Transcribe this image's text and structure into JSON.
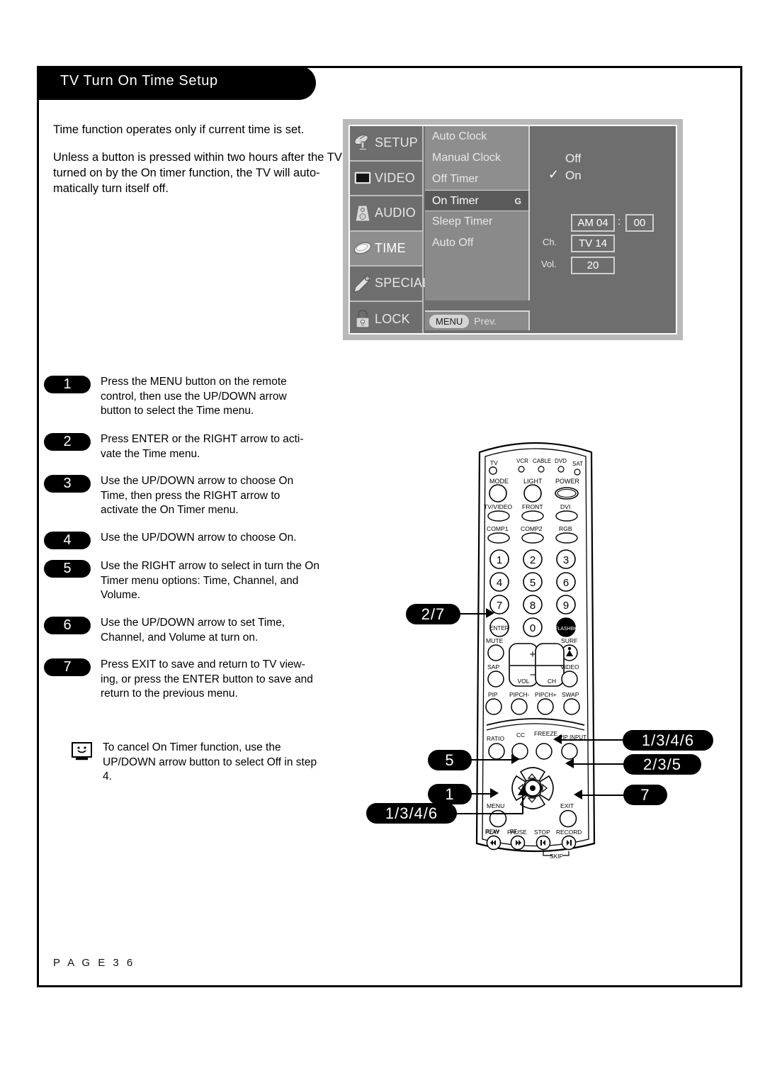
{
  "header": {
    "title": "TV Turn On Time Setup"
  },
  "intro": {
    "p1": "Time function operates only if current time is set.",
    "p2": "Unless a button is pressed within two hours after the TV is turned on by the On timer function, the TV will auto-matically turn itself off."
  },
  "osd": {
    "categories": [
      {
        "label": "SETUP",
        "icon": "satellite-dish-icon",
        "selected": false
      },
      {
        "label": "VIDEO",
        "icon": "tv-screen-icon",
        "selected": false
      },
      {
        "label": "AUDIO",
        "icon": "speaker-icon",
        "selected": false
      },
      {
        "label": "TIME",
        "icon": "clock-disc-icon",
        "selected": true
      },
      {
        "label": "SPECIAL",
        "icon": "key-icon",
        "selected": false
      },
      {
        "label": "LOCK",
        "icon": "padlock-icon",
        "selected": false
      }
    ],
    "items": [
      {
        "label": "Auto Clock",
        "highlighted": false,
        "marker": ""
      },
      {
        "label": "Manual Clock",
        "highlighted": false,
        "marker": ""
      },
      {
        "label": "Off Timer",
        "highlighted": false,
        "marker": ""
      },
      {
        "label": "On Timer",
        "highlighted": true,
        "marker": "G"
      },
      {
        "label": "Sleep Timer",
        "highlighted": false,
        "marker": ""
      },
      {
        "label": "Auto Off",
        "highlighted": false,
        "marker": ""
      }
    ],
    "footer": {
      "menu_pill": "MENU",
      "prev_label": "Prev."
    },
    "options": {
      "off": "Off",
      "on": "On",
      "checkmark": "✓"
    },
    "values": {
      "ampm_hour": "AM 04",
      "colon": ":",
      "minute": "00",
      "ch_label": "Ch.",
      "ch_value": "TV  14",
      "vol_label": "Vol.",
      "vol_value": "20"
    }
  },
  "steps": [
    {
      "num": "1",
      "text": "Press the MENU button on the remote control, then use the UP/DOWN arrow button to select the Time menu."
    },
    {
      "num": "2",
      "text": "Press ENTER or the RIGHT arrow to acti-vate the Time menu."
    },
    {
      "num": "3",
      "text": "Use the UP/DOWN arrow to choose On Time, then press the RIGHT arrow to activate the On Timer menu."
    },
    {
      "num": "4",
      "text": "Use the UP/DOWN arrow to choose On."
    },
    {
      "num": "5",
      "text": "Use the RIGHT arrow to select in turn the On Timer menu options: Time, Channel, and Volume."
    },
    {
      "num": "6",
      "text": "Use the UP/DOWN arrow to set Time, Channel, and Volume at turn on."
    },
    {
      "num": "7",
      "text": "Press EXIT to save and return to TV view-ing, or press the ENTER button to save and return to the previous menu."
    }
  ],
  "note": {
    "icon": "smiley-tv-icon",
    "text": "To cancel On Timer function, use the UP/DOWN arrow button to select Off in step 4."
  },
  "callouts": {
    "enter": "2/7",
    "left_arrow": "5",
    "menu": "1",
    "down_arrow": "1/3/4/6",
    "up_arrow": "1/3/4/6",
    "right_arrow": "2/3/5",
    "exit": "7"
  },
  "remote": {
    "device_leds": [
      "TV",
      "VCR",
      "CABLE",
      "DVD",
      "SAT"
    ],
    "row_mode": [
      "MODE",
      "LIGHT",
      "POWER"
    ],
    "row_input1": [
      "TV/VIDEO",
      "FRONT",
      "DVI"
    ],
    "row_input2": [
      "COMP1",
      "COMP2",
      "RGB"
    ],
    "keypad": [
      "1",
      "2",
      "3",
      "4",
      "5",
      "6",
      "7",
      "8",
      "9",
      "ENTER",
      "0",
      "FLASHBK"
    ],
    "row_mute": [
      "MUTE",
      "SURF"
    ],
    "row_sap": [
      "SAP",
      "VIDEO"
    ],
    "rockers": [
      "VOL",
      "CH",
      "+",
      "−"
    ],
    "row_pip": [
      "PIP",
      "PIPCH-",
      "PIPCH+",
      "SWAP"
    ],
    "row_ratio": [
      "RATIO",
      "CC",
      "FREEZE",
      "PIP INPUT"
    ],
    "nav": [
      "MENU",
      "EXIT"
    ],
    "row_transport": [
      "PLAY",
      "PAUSE",
      "STOP",
      "RECORD"
    ],
    "row_transport2": [
      "REW",
      "FF"
    ],
    "skip_label": "SKIP"
  },
  "footer": {
    "page": "P A G E   3 6"
  }
}
